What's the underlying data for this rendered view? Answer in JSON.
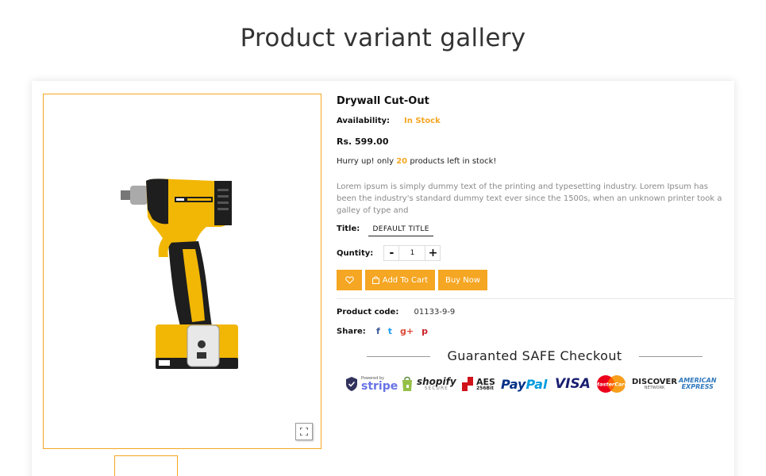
{
  "page": {
    "title": "Product variant gallery"
  },
  "product": {
    "name": "Drywall Cut-Out",
    "availability_label": "Availability:",
    "availability_value": "In Stock",
    "price": "Rs. 599.00",
    "hurry_prefix": "Hurry up! only",
    "stock_count": "20",
    "hurry_suffix": "products left in stock!",
    "description": "Lorem ipsum is simply dummy text of the printing and typesetting industry. Lorem Ipsum has been the industry's standard dummy text ever since the 1500s, when an unknown printer took a galley of type and",
    "title_label": "Title:",
    "title_value": "DEFAULT TITLE",
    "quantity_label": "Quntity:",
    "quantity_value": "1",
    "minus": "-",
    "plus": "+",
    "add_to_cart": "Add To Cart",
    "buy_now": "Buy Now",
    "code_label": "Product code:",
    "code_value": "01133-9-9",
    "share_label": "Share:",
    "share_icons": {
      "facebook": "f",
      "twitter": "t",
      "googleplus": "g+",
      "pinterest": "p"
    }
  },
  "checkout": {
    "heading": "Guaranted SAFE Checkout",
    "logos": {
      "stripe_small": "Powered by",
      "stripe": "stripe",
      "shopify": "shopify",
      "shopify_sub": "SECURE",
      "aes": "AES",
      "aes_sub": "256Bit",
      "paypal_a": "Pay",
      "paypal_b": "Pal",
      "visa": "VISA",
      "mastercard": "MasterCard",
      "discover": "DISCOVER",
      "discover_sub": "NETWORK",
      "amex_a": "AMERICAN",
      "amex_b": "EXPRESS"
    }
  },
  "colors": {
    "accent": "#f5a623",
    "drill_yellow": "#f2b705",
    "drill_black": "#1e1e1e"
  }
}
